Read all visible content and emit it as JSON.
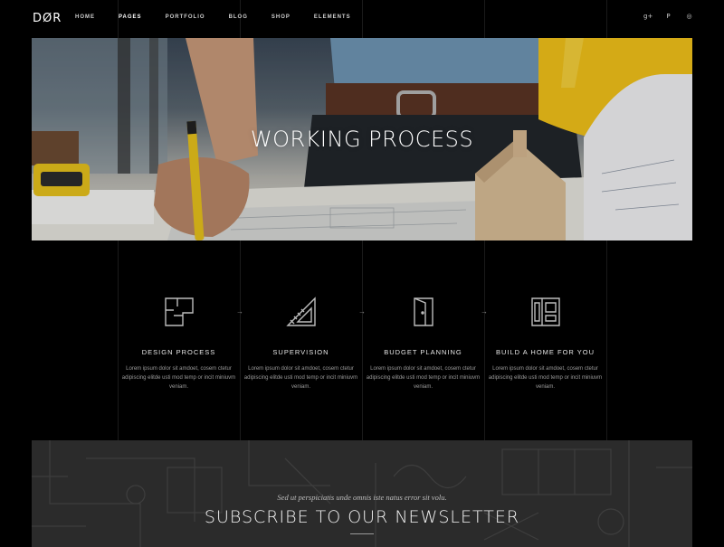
{
  "brand": {
    "logo": "DØR"
  },
  "nav": {
    "items": [
      {
        "label": "HOME",
        "active": false
      },
      {
        "label": "PAGES",
        "active": true
      },
      {
        "label": "PORTFOLIO",
        "active": false
      },
      {
        "label": "BLOG",
        "active": false
      },
      {
        "label": "SHOP",
        "active": false
      },
      {
        "label": "ELEMENTS",
        "active": false
      }
    ]
  },
  "social": [
    {
      "icon": "google-plus-icon",
      "glyph": "g+"
    },
    {
      "icon": "pinterest-icon",
      "glyph": "P"
    },
    {
      "icon": "dribbble-icon",
      "glyph": "◎"
    }
  ],
  "hero": {
    "title": "WORKING PROCESS"
  },
  "process": {
    "steps": [
      {
        "icon": "floor-plan-icon",
        "title": "DESIGN PROCESS",
        "text": "Lorem ipsum dolor sit amdoet, cosem ctetur adipiscing elitde usti mod temp or incit miniuvm veniam."
      },
      {
        "icon": "set-square-ruler-icon",
        "title": "SUPERVISION",
        "text": "Lorem ipsum dolor sit amdoet, cosem ctetur adipiscing elitde usti mod temp or incit miniuvm veniam."
      },
      {
        "icon": "door-icon",
        "title": "BUDGET PLANNING",
        "text": "Lorem ipsum dolor sit amdoet, cosem ctetur adipiscing elitde usti mod temp or incit miniuvm veniam."
      },
      {
        "icon": "wardrobe-icon",
        "title": "BUILD A HOME FOR YOU",
        "text": "Lorem ipsum dolor sit amdoet, cosem ctetur adipiscing elitde usti mod temp or incit miniuvm veniam."
      }
    ],
    "arrow_glyph": "→"
  },
  "newsletter": {
    "kicker": "Sed ut perspiciatis unde omnis iste natus error sit volu.",
    "title": "SUBSCRIBE TO OUR NEWSLETTER"
  },
  "colors": {
    "background": "#000000",
    "newsletter_bg": "#2b2b2b",
    "helmet": "#f2c21a",
    "pencil": "#e8c21c"
  }
}
